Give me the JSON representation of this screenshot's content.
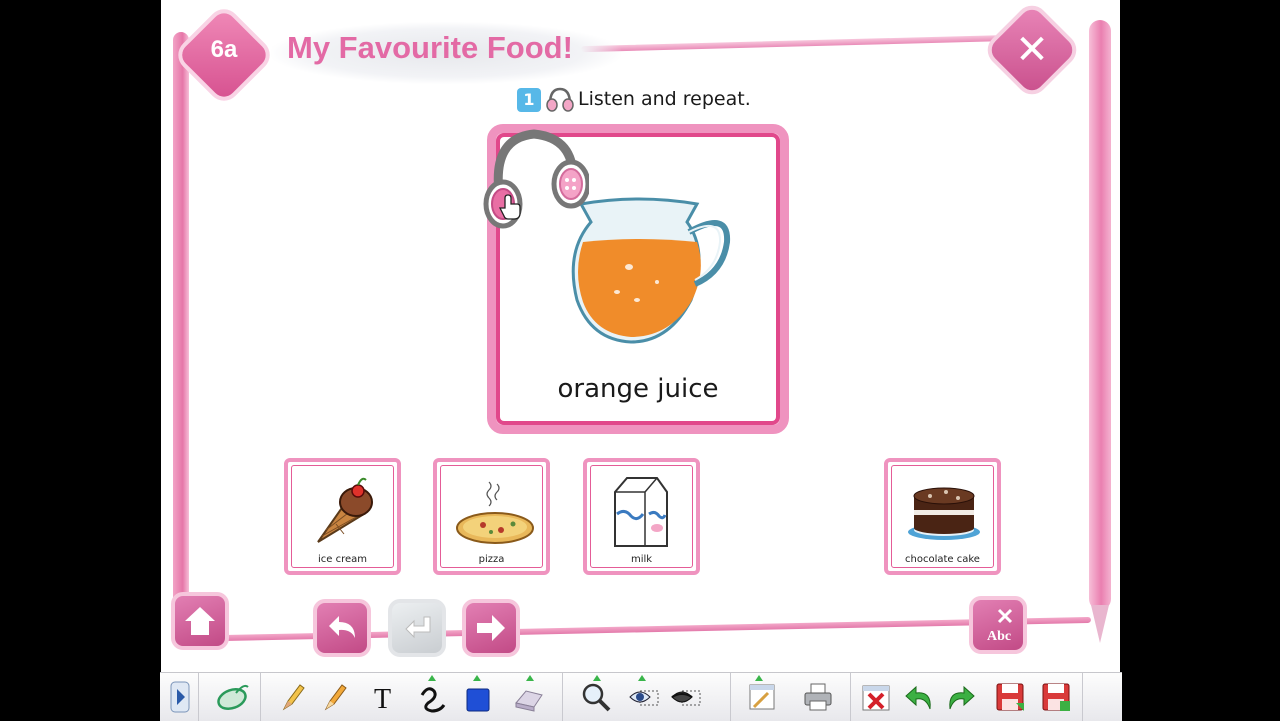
{
  "header": {
    "unit_badge": "6a",
    "title": "My Favourite Food!",
    "close_glyph": "✕"
  },
  "instruction": {
    "step_number": "1",
    "text": "Listen and repeat."
  },
  "main_card": {
    "caption": "orange juice",
    "image": "orange-juice-jug",
    "audio_icon": "headphones-icon"
  },
  "cards": [
    {
      "label": "ice cream",
      "image": "ice-cream-cone"
    },
    {
      "label": "pizza",
      "image": "pizza"
    },
    {
      "label": "milk",
      "image": "milk-carton"
    },
    {
      "label": "chocolate cake",
      "image": "chocolate-cake"
    }
  ],
  "navigation": {
    "home": "home-icon",
    "back": "undo-arrow-icon",
    "return": "return-arrow-icon (disabled)",
    "next": "next-arrow-icon",
    "abc": "abc-tool-icon",
    "abc_label": "Abc"
  },
  "toolbar": {
    "text_tool_label": "T",
    "items": [
      "expand-toolbar-icon",
      "mouse-pointer-icon",
      "pencil-icon",
      "highlighter-icon",
      "text-tool-icon",
      "freehand-icon",
      "shape-icon",
      "eraser-icon",
      "zoom-icon",
      "reveal-icon",
      "hide-icon",
      "window-icon",
      "print-icon",
      "delete-icon",
      "undo-icon",
      "redo-icon",
      "save-icon",
      "save-as-icon"
    ]
  },
  "colors": {
    "frame_pink": "#e676a8",
    "title_pink": "#e36aa5",
    "card_border": "#ef93bf",
    "step_blue": "#57b8e8"
  }
}
